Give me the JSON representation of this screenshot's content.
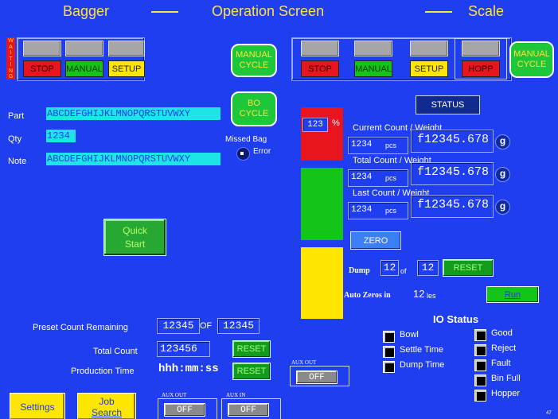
{
  "header": {
    "left_title": "Bagger",
    "center_title": "Operation Screen",
    "right_title": "Scale"
  },
  "waiting_label": "WAITING",
  "bagger_controls": {
    "stop": "STOP",
    "manual": "MANUAL",
    "setup": "SETUP",
    "manual_cycle_line1": "MANUAL",
    "manual_cycle_line2": "CYCLE",
    "bo_cycle_line1": "BO",
    "bo_cycle_line2": "CYCLE"
  },
  "scale_controls": {
    "stop": "STOP",
    "manual": "MANUAL",
    "setup": "SETUP",
    "hopp": "HOPP",
    "manual_cycle_line1": "MANUAL",
    "manual_cycle_line2": "CYCLE"
  },
  "job": {
    "part_label": "Part",
    "part_value": "ABCDEFGHIJKLMNOPQRSTUVWXY",
    "qty_label": "Qty",
    "qty_value": "1234",
    "note_label": "Note",
    "note_value": "ABCDEFGHIJKLMNOPQRSTUVWXY"
  },
  "missed_bag": {
    "line1": "Missed Bag",
    "line2": "Error"
  },
  "quick_start": {
    "line1": "Quick",
    "line2": "Start"
  },
  "fill_meter": {
    "percent_value": "123",
    "percent_unit": "%",
    "zones": [
      "#e8141e",
      "#15c418",
      "#ffe600"
    ]
  },
  "status": {
    "button": "STATUS"
  },
  "weights": [
    {
      "label": "Current Count / Weight",
      "count": "1234",
      "count_unit": "pcs",
      "weight": "f12345.678",
      "weight_unit": "g"
    },
    {
      "label": "Total Count / Weight",
      "count": "1234",
      "count_unit": "pcs",
      "weight": "f12345.678",
      "weight_unit": "g"
    },
    {
      "label": "Last Count / Weight",
      "count": "1234",
      "count_unit": "pcs",
      "weight": "f12345.678",
      "weight_unit": "g"
    }
  ],
  "zero_button": "ZERO",
  "dump": {
    "label": "Dump",
    "current": "12",
    "of": "of",
    "total": "12",
    "reset": "RESET"
  },
  "auto_zero": {
    "label": "Auto Zeros in",
    "value": "12",
    "unit": "les",
    "run": "Run"
  },
  "counts": {
    "preset_label": "Preset Count Remaining",
    "preset_value": "12345",
    "preset_of": "OF",
    "preset_total": "12345",
    "total_label": "Total Count",
    "total_value": "123456",
    "total_reset": "RESET",
    "production_label": "Production Time",
    "production_value": "hhh:mm:ss",
    "production_reset": "RESET"
  },
  "aux": {
    "mid_label": "AUX OUT",
    "mid_value": "OFF",
    "bottom_out_label": "AUX OUT",
    "bottom_out_value": "OFF",
    "bottom_in_label": "AUX IN",
    "bottom_in_value": "OFF"
  },
  "bottom_buttons": {
    "settings": "Settings",
    "job_line1": "Job",
    "job_line2": "Search"
  },
  "io_status": {
    "title": "IO Status",
    "left": [
      "Bowl",
      "Settle Time",
      "Dump Time"
    ],
    "right": [
      "Good",
      "Reject",
      "Fault",
      "Bin Full",
      "Hopper"
    ]
  },
  "corner_number": "47"
}
